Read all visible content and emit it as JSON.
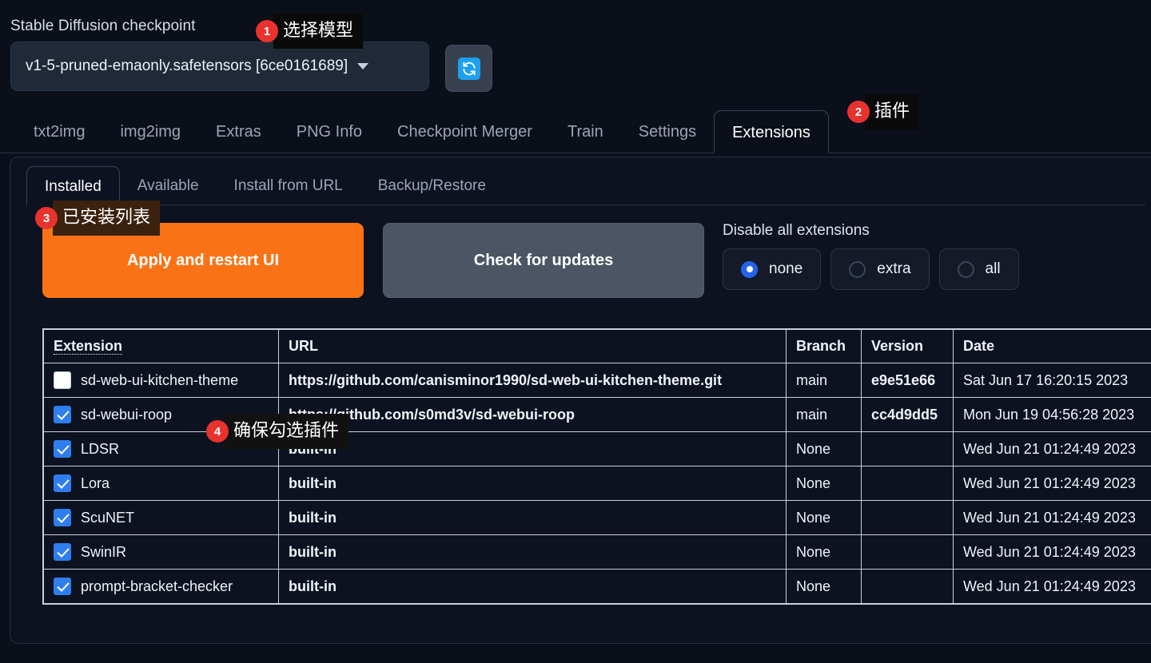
{
  "checkpoint": {
    "label": "Stable Diffusion checkpoint",
    "value": "v1-5-pruned-emaonly.safetensors [6ce0161689]",
    "refresh_icon": "refresh-icon",
    "caret_icon": "chevron-down-icon"
  },
  "main_tabs": [
    {
      "label": "txt2img",
      "active": false
    },
    {
      "label": "img2img",
      "active": false
    },
    {
      "label": "Extras",
      "active": false
    },
    {
      "label": "PNG Info",
      "active": false
    },
    {
      "label": "Checkpoint Merger",
      "active": false
    },
    {
      "label": "Train",
      "active": false
    },
    {
      "label": "Settings",
      "active": false
    },
    {
      "label": "Extensions",
      "active": true
    }
  ],
  "sub_tabs": [
    {
      "label": "Installed",
      "active": true
    },
    {
      "label": "Available",
      "active": false
    },
    {
      "label": "Install from URL",
      "active": false
    },
    {
      "label": "Backup/Restore",
      "active": false
    }
  ],
  "actions": {
    "apply_label": "Apply and restart UI",
    "check_label": "Check for updates",
    "apply_color": "#f97316"
  },
  "disable_all": {
    "label": "Disable all extensions",
    "options": [
      {
        "label": "none",
        "selected": true
      },
      {
        "label": "extra",
        "selected": false
      },
      {
        "label": "all",
        "selected": false
      }
    ]
  },
  "table": {
    "headers": [
      "Extension",
      "URL",
      "Branch",
      "Version",
      "Date"
    ],
    "rows": [
      {
        "checked": false,
        "extension": "sd-web-ui-kitchen-theme",
        "url": "https://github.com/canisminor1990/sd-web-ui-kitchen-theme.git",
        "branch": "main",
        "version": "e9e51e66",
        "date": "Sat Jun 17 16:20:15 2023"
      },
      {
        "checked": true,
        "extension": "sd-webui-roop",
        "url": "https://github.com/s0md3v/sd-webui-roop",
        "branch": "main",
        "version": "cc4d9dd5",
        "date": "Mon Jun 19 04:56:28 2023"
      },
      {
        "checked": true,
        "extension": "LDSR",
        "url": "built-in",
        "branch": "None",
        "version": "",
        "date": "Wed Jun 21 01:24:49 2023"
      },
      {
        "checked": true,
        "extension": "Lora",
        "url": "built-in",
        "branch": "None",
        "version": "",
        "date": "Wed Jun 21 01:24:49 2023"
      },
      {
        "checked": true,
        "extension": "ScuNET",
        "url": "built-in",
        "branch": "None",
        "version": "",
        "date": "Wed Jun 21 01:24:49 2023"
      },
      {
        "checked": true,
        "extension": "SwinIR",
        "url": "built-in",
        "branch": "None",
        "version": "",
        "date": "Wed Jun 21 01:24:49 2023"
      },
      {
        "checked": true,
        "extension": "prompt-bracket-checker",
        "url": "built-in",
        "branch": "None",
        "version": "",
        "date": "Wed Jun 21 01:24:49 2023"
      }
    ]
  },
  "annotations": [
    {
      "number": "1",
      "text": "选择模型"
    },
    {
      "number": "2",
      "text": "插件"
    },
    {
      "number": "3",
      "text": "已安装列表"
    },
    {
      "number": "4",
      "text": "确保勾选插件"
    }
  ]
}
